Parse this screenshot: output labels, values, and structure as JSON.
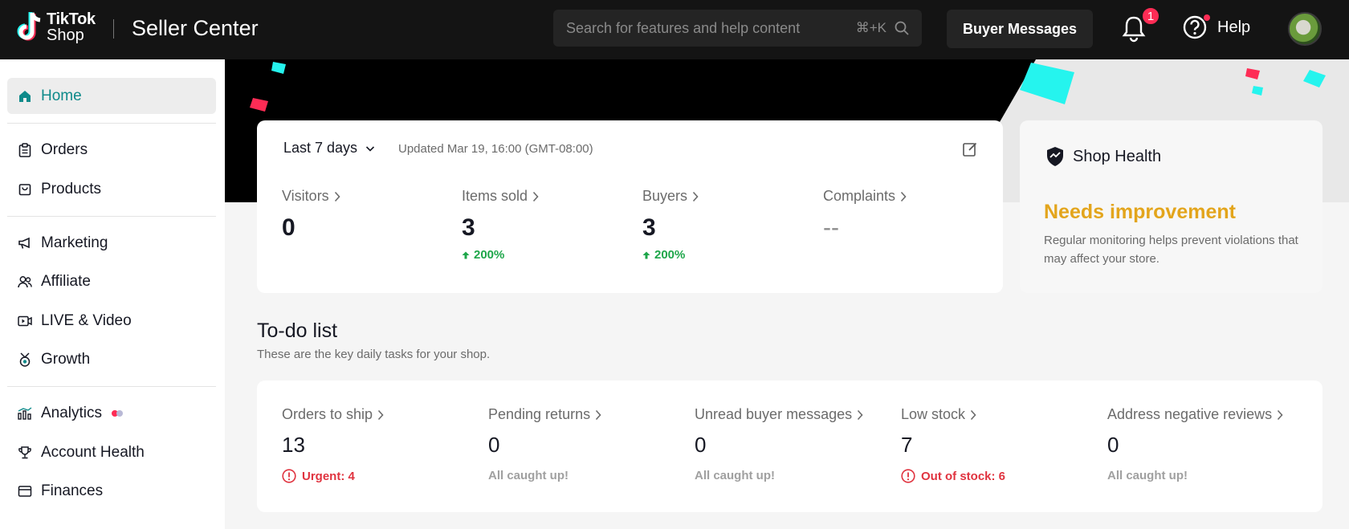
{
  "header": {
    "logo_line1": "TikTok",
    "logo_line2": "Shop",
    "title": "Seller Center",
    "search_placeholder": "Search for features and help content",
    "search_shortcut": "⌘+K",
    "buyer_messages_label": "Buyer Messages",
    "notifications_count": "1",
    "help_label": "Help"
  },
  "sidebar": {
    "items": [
      {
        "label": "Home"
      },
      {
        "label": "Orders"
      },
      {
        "label": "Products"
      },
      {
        "label": "Marketing"
      },
      {
        "label": "Affiliate"
      },
      {
        "label": "LIVE & Video"
      },
      {
        "label": "Growth"
      },
      {
        "label": "Analytics"
      },
      {
        "label": "Account Health"
      },
      {
        "label": "Finances"
      }
    ]
  },
  "metrics": {
    "range_label": "Last 7 days",
    "updated_text": "Updated Mar 19, 16:00 (GMT-08:00)",
    "items": [
      {
        "label": "Visitors",
        "value": "0",
        "delta": ""
      },
      {
        "label": "Items sold",
        "value": "3",
        "delta": "200%"
      },
      {
        "label": "Buyers",
        "value": "3",
        "delta": "200%"
      },
      {
        "label": "Complaints",
        "value": "--",
        "delta": ""
      }
    ]
  },
  "shop_health": {
    "title": "Shop Health",
    "status": "Needs improvement",
    "description": "Regular monitoring helps prevent violations that may affect your store."
  },
  "todo": {
    "title": "To-do list",
    "subtitle": "These are the key daily tasks for your shop.",
    "items": [
      {
        "label": "Orders to ship",
        "value": "13",
        "status": "Urgent: 4"
      },
      {
        "label": "Pending returns",
        "value": "0",
        "status": "All caught up!"
      },
      {
        "label": "Unread buyer messages",
        "value": "0",
        "status": "All caught up!"
      },
      {
        "label": "Low stock",
        "value": "7",
        "status": "Out of stock: 6"
      },
      {
        "label": "Address negative reviews",
        "value": "0",
        "status": "All caught up!"
      }
    ]
  },
  "colors": {
    "accent": "#0e8a8a",
    "warning": "#e3a51c",
    "urgent": "#e0333f",
    "positive": "#1ea64a"
  }
}
